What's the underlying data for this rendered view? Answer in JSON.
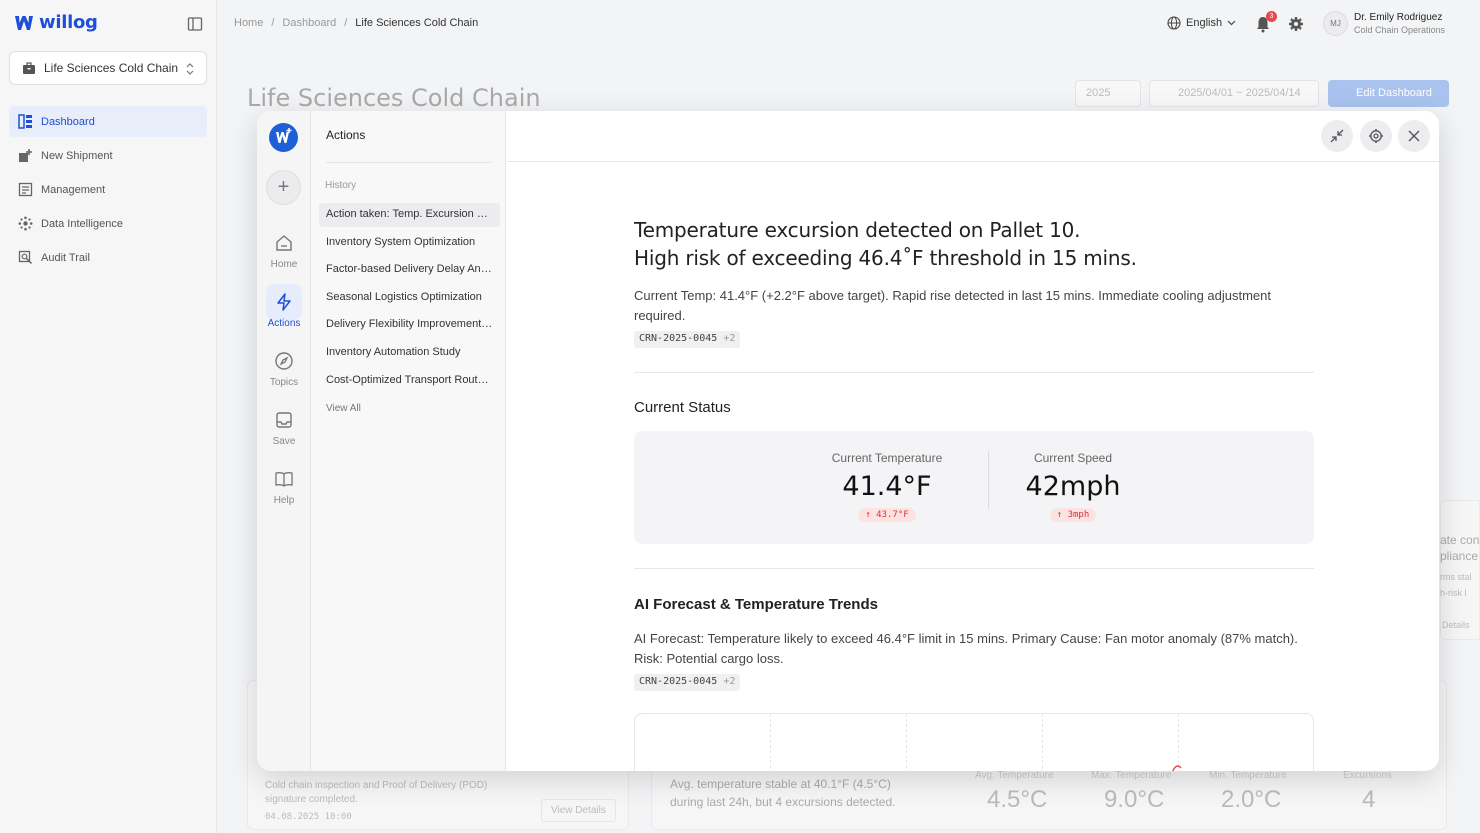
{
  "app": {
    "brand": "willog",
    "accent": "#1d4fd8"
  },
  "sidebar": {
    "workspace": "Life Sciences Cold Chain",
    "items": [
      {
        "label": "Dashboard",
        "icon": "dashboard-icon",
        "active": true
      },
      {
        "label": "New Shipment",
        "icon": "new-shipment-icon"
      },
      {
        "label": "Management",
        "icon": "management-icon"
      },
      {
        "label": "Data Intelligence",
        "icon": "data-intelligence-icon"
      },
      {
        "label": "Audit Trail",
        "icon": "audit-trail-icon"
      }
    ]
  },
  "topbar": {
    "breadcrumb": [
      "Home",
      "Dashboard",
      "Life Sciences Cold Chain"
    ],
    "language": "English",
    "notifications": "3",
    "user": {
      "initials": "MJ",
      "name": "Dr. Emily Rodriguez",
      "role": "Cold Chain Operations"
    }
  },
  "background": {
    "title": "Life Sciences Cold Chain",
    "year": "2025",
    "range": "2025/04/01 ~ 2025/04/14",
    "edit": "Edit Dashboard",
    "pod_text": "Cold chain inspection and Proof of Delivery (POD) signature completed.",
    "pod_time": "04.08.2025 10:00",
    "view_details": "View Details",
    "stable_text": "Avg. temperature stable at 40.1°F (4.5°C) during last 24h, but 4 excursions detected.",
    "stats": [
      {
        "label": "Avg. Temperature",
        "value": "4.5°C"
      },
      {
        "label": "Max. Temperature",
        "value": "9.0°C"
      },
      {
        "label": "Min. Temperature",
        "value": "2.0°C"
      },
      {
        "label": "Excursions",
        "value": "4"
      }
    ],
    "right_frag": [
      "ate con",
      "pliance",
      "rms stal",
      "h-risk l",
      "Details"
    ]
  },
  "modal": {
    "rail": [
      {
        "label": "Home",
        "icon": "home-icon"
      },
      {
        "label": "Actions",
        "icon": "lightning-icon",
        "active": true
      },
      {
        "label": "Topics",
        "icon": "compass-icon"
      },
      {
        "label": "Save",
        "icon": "inbox-icon"
      },
      {
        "label": "Help",
        "icon": "book-icon"
      }
    ],
    "panel_title": "Actions",
    "history_label": "History",
    "history": [
      "Action taken: Temp. Excursion Response",
      "Inventory System Optimization",
      "Factor-based Delivery Delay Analysis",
      "Seasonal Logistics Optimization",
      "Delivery Flexibility Improvement Plan",
      "Inventory Automation Study",
      "Cost-Optimized Transport Route Review"
    ],
    "view_all": "View All",
    "alert_line1": "Temperature excursion detected on Pallet 10.",
    "alert_line2": "High risk of exceeding 46.4˚F threshold in 15 mins.",
    "alert_desc": "Current Temp: 41.4°F (+2.2°F above target). Rapid rise detected in last 15 mins. Immediate cooling adjustment required.",
    "tag": "CRN-2025-0045",
    "tag_more": "+2",
    "status_title": "Current Status",
    "metrics": [
      {
        "label": "Current Temperature",
        "value": "41.4°F",
        "delta": "↑ 43.7°F"
      },
      {
        "label": "Current Speed",
        "value": "42mph",
        "delta": "↑ 3mph"
      }
    ],
    "forecast_title": "AI Forecast & Temperature Trends",
    "forecast_desc": "AI Forecast: Temperature likely to exceed 46.4°F limit in 15 mins. Primary Cause: Fan motor anomaly (87% match). Risk: Potential cargo loss."
  }
}
